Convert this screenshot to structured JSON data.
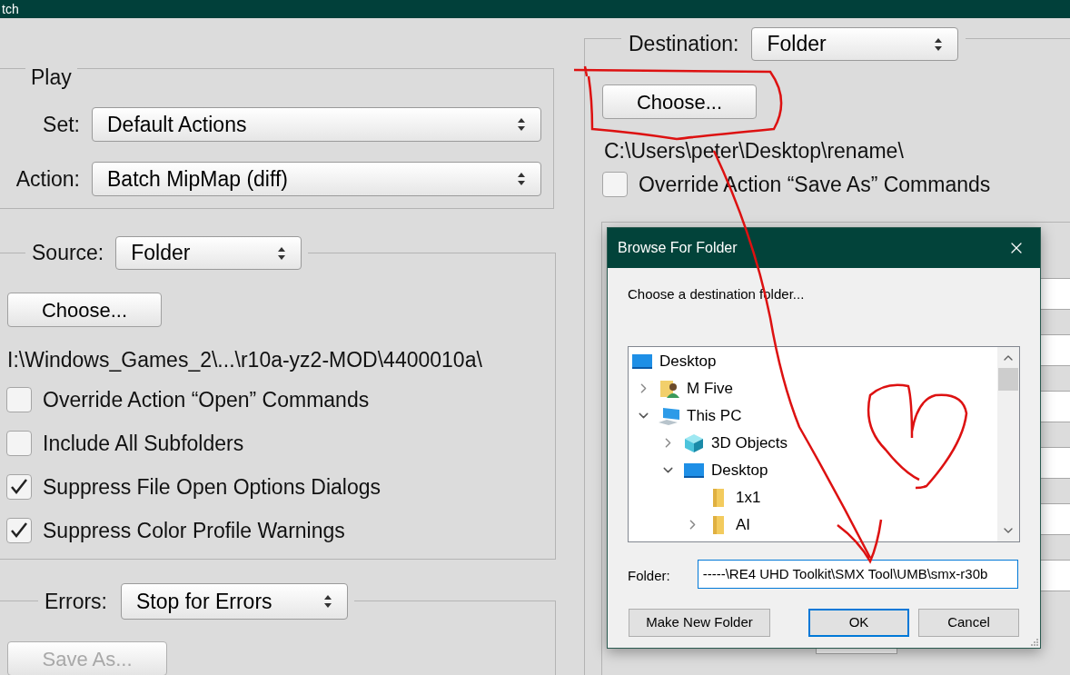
{
  "window": {
    "title": "tch"
  },
  "play": {
    "legend": "Play",
    "set": {
      "label": "Set:",
      "value": "Default Actions"
    },
    "action": {
      "label": "Action:",
      "value": "Batch MipMap (diff)"
    }
  },
  "source": {
    "label": "Source:",
    "value": "Folder",
    "choose_button": "Choose...",
    "path": "I:\\Windows_Games_2\\...\\r10a-yz2-MOD\\4400010a\\",
    "options": [
      {
        "label": "Override Action “Open” Commands",
        "checked": false
      },
      {
        "label": "Include All Subfolders",
        "checked": false
      },
      {
        "label": "Suppress File Open Options Dialogs",
        "checked": true
      },
      {
        "label": "Suppress Color Profile Warnings",
        "checked": true
      }
    ]
  },
  "errors": {
    "label": "Errors:",
    "value": "Stop for Errors",
    "save_as_button": {
      "label": "Save As...",
      "disabled": true
    }
  },
  "destination": {
    "label": "Destination:",
    "value": "Folder",
    "choose_button": "Choose...",
    "path": "C:\\Users\\peter\\Desktop\\rename\\",
    "options": [
      {
        "label": "Override Action “Save As” Commands",
        "checked": false
      }
    ]
  },
  "dialog": {
    "title": "Browse For Folder",
    "prompt": "Choose a destination folder...",
    "tree": [
      {
        "label": "Desktop",
        "kind": "desktop",
        "children": [
          {
            "label": "M Five",
            "kind": "user",
            "expanded": false
          },
          {
            "label": "This PC",
            "kind": "pc",
            "expanded": true,
            "children": [
              {
                "label": "3D Objects",
                "kind": "objects3d",
                "expanded": false
              },
              {
                "label": "Desktop",
                "kind": "desktop",
                "expanded": true,
                "children": [
                  {
                    "label": "1x1",
                    "kind": "folder"
                  },
                  {
                    "label": "AI",
                    "kind": "folder",
                    "expanded": false
                  }
                ]
              }
            ]
          }
        ]
      }
    ],
    "folder": {
      "label": "Folder:",
      "value": "-----\\RE4 UHD Toolkit\\SMX Tool\\UMB\\smx-r30b"
    },
    "buttons": [
      {
        "label": "Make New Folder",
        "default": false
      },
      {
        "label": "OK",
        "default": true
      },
      {
        "label": "Cancel",
        "default": false
      }
    ]
  }
}
